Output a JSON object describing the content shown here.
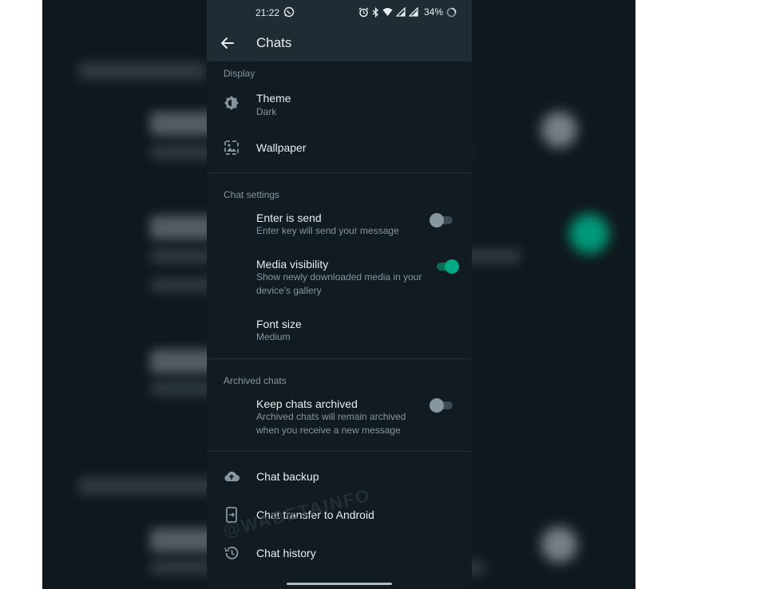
{
  "status_bar": {
    "time": "21:22",
    "battery": "34%"
  },
  "app_bar": {
    "title": "Chats",
    "back_icon": "arrow-left-icon"
  },
  "display": {
    "header": "Display",
    "theme": {
      "title": "Theme",
      "value": "Dark",
      "icon": "brightness-icon"
    },
    "wallpaper": {
      "title": "Wallpaper",
      "icon": "wallpaper-icon"
    }
  },
  "chat_settings": {
    "header": "Chat settings",
    "enter_is_send": {
      "title": "Enter is send",
      "subtitle": "Enter key will send your message",
      "enabled": false
    },
    "media_visibility": {
      "title": "Media visibility",
      "subtitle": "Show newly downloaded media in your device's gallery",
      "enabled": true
    },
    "font_size": {
      "title": "Font size",
      "value": "Medium"
    }
  },
  "archived_chats": {
    "header": "Archived chats",
    "keep_chats_archived": {
      "title": "Keep chats archived",
      "subtitle": "Archived chats will remain archived when you receive a new message",
      "enabled": false
    }
  },
  "other": {
    "chat_backup": {
      "title": "Chat backup",
      "icon": "cloud-upload-icon"
    },
    "chat_transfer": {
      "title": "Chat transfer to Android",
      "icon": "phone-transfer-icon"
    },
    "chat_history": {
      "title": "Chat history",
      "icon": "history-icon"
    }
  },
  "watermark": "@WABETAINFO",
  "colors": {
    "background": "#111b21",
    "bar": "#1f2c33",
    "accent": "#00a884",
    "primary_text": "#e9edef",
    "secondary_text": "#8696a0"
  }
}
